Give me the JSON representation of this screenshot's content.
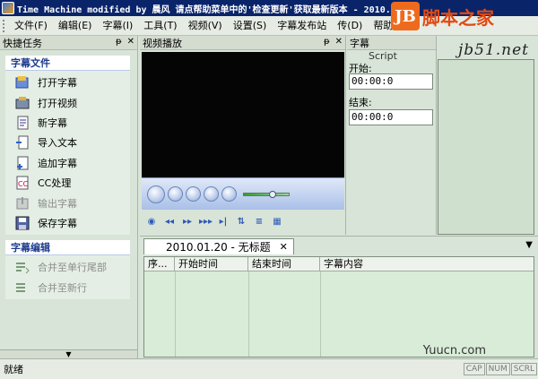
{
  "window": {
    "title": "Time Machine modified by 晨风 请点帮助菜单中的'检查更新'获取最新版本 - 2010.0."
  },
  "watermark": {
    "logo_letters": "JB",
    "site_name": "脚本之家",
    "url": "jb51.net",
    "bottom": "Yuucn.com"
  },
  "menu": [
    "文件(F)",
    "编辑(E)",
    "字幕(I)",
    "工具(T)",
    "视频(V)",
    "设置(S)",
    "字幕发布站",
    "传(D)",
    "帮助"
  ],
  "quick_tasks": {
    "title": "快捷任务",
    "pin": "ᵽ",
    "close": "✕",
    "groups": [
      {
        "title": "字幕文件",
        "items": [
          {
            "label": "打开字幕",
            "icon": "open-subtitle-icon",
            "enabled": true
          },
          {
            "label": "打开视频",
            "icon": "open-video-icon",
            "enabled": true
          },
          {
            "label": "新字幕",
            "icon": "new-subtitle-icon",
            "enabled": true
          },
          {
            "label": "导入文本",
            "icon": "import-text-icon",
            "enabled": true
          },
          {
            "label": "追加字幕",
            "icon": "append-subtitle-icon",
            "enabled": true
          },
          {
            "label": "CC处理",
            "icon": "cc-process-icon",
            "enabled": true
          },
          {
            "label": "输出字幕",
            "icon": "export-subtitle-icon",
            "enabled": false
          },
          {
            "label": "保存字幕",
            "icon": "save-subtitle-icon",
            "enabled": true
          }
        ]
      },
      {
        "title": "字幕编辑",
        "items": [
          {
            "label": "合并至单行尾部",
            "icon": "merge-tail-icon",
            "enabled": false
          },
          {
            "label": "合并至新行",
            "icon": "merge-newline-icon",
            "enabled": false
          }
        ]
      }
    ]
  },
  "video_panel": {
    "title": "视频播放",
    "pin": "ᵽ",
    "close": "✕"
  },
  "script_panel": {
    "title": "字幕",
    "subtitle": "Script",
    "start_label": "开始:",
    "start_value": "00:00:0",
    "end_label": "结束:",
    "end_value": "00:00:0"
  },
  "document": {
    "tab_label": "2010.01.20 - 无标题",
    "tab_close": "✕",
    "dropdown": "▼",
    "columns": [
      "序...",
      "开始时间",
      "结束时间",
      "字幕内容"
    ]
  },
  "status": {
    "text": "就绪",
    "indicators": [
      "CAP",
      "NUM",
      "SCRL"
    ]
  }
}
